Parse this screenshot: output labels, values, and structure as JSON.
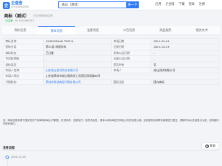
{
  "header": {
    "logo_mark": "企",
    "logo_main": "企查查",
    "logo_sub": "企业信用信息查询",
    "search_value": "成山（测试）",
    "search_button": "查一下",
    "nav": [
      "应用",
      "企业版",
      "下载",
      "登录",
      "注册"
    ]
  },
  "company": {
    "title": "商标（测试）",
    "subtitle": "已注册商标信息",
    "tag": "已注册",
    "reg_id": "ID 2024060315"
  },
  "tabs": [
    {
      "label": "商标信息",
      "active": false
    },
    {
      "label": "基本信息",
      "active": true
    },
    {
      "label": "注册流程",
      "active": false
    },
    {
      "label": "公告信息",
      "active": false
    },
    {
      "label": "商品服务",
      "active": false
    },
    {
      "label": "相关文书",
      "active": false
    }
  ],
  "table": [
    {
      "l1": "商标名称",
      "v1": "CHENGSHAN TEST-A",
      "l2": "申请日期",
      "v2": "2024-02-06"
    },
    {
      "l1": "国际分类",
      "v1": "第32类 啤酒饮料",
      "l2": "注册日期",
      "v2": "2024-10-28"
    },
    {
      "l1": "商标状态",
      "v1": "已注册",
      "l2": "初审公告日期",
      "v2": "-"
    },
    {
      "l1": "专用权期限",
      "v1": "-",
      "l2": "注册公告日期",
      "v2": "-"
    },
    {
      "l1": "商标类型",
      "v1": "-",
      "l2": "是否共有",
      "v2": "否"
    },
    {
      "l1": "申请人名称",
      "v1": "山东成山测试实业有限公司",
      "l2": "申请人",
      "v2": "成山测试有限公司"
    },
    {
      "l1": "申请人地址",
      "v1": "山东省荣成市成山镇测试工业园区测试路88号",
      "l2": "",
      "v2": ""
    },
    {
      "l1": "代理机构",
      "v1": "荣成市测试商标代理有限公司",
      "l2": "国际注册",
      "v2": "国内商标"
    }
  ],
  "description": "注：商标信息来源于国家知识产权局商标局公开数据，仅供参考，信息存在一定的滞后性，具体以商标局官方网站公布的信息为准。如信息有误请联系客服进行更正，更新时间以页面显示为准，如有疑问可联系我们。",
  "timeline": {
    "title": "注册流程",
    "float_button": "帮助",
    "items": [
      {
        "date": "2024-11-20"
      }
    ]
  }
}
